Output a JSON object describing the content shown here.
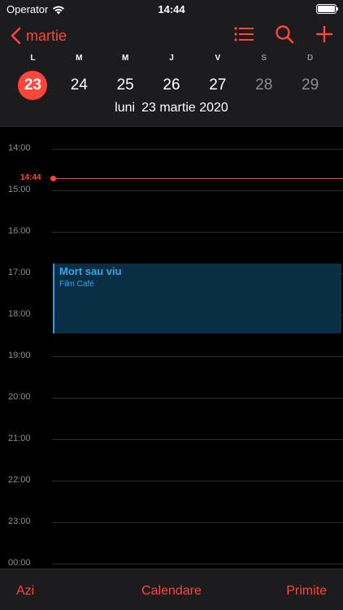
{
  "status_bar": {
    "carrier": "Operator",
    "time": "14:44"
  },
  "nav": {
    "back_label": "martie",
    "accent_color": "#ff453a",
    "icons": [
      "list-icon",
      "search-icon",
      "plus-icon"
    ]
  },
  "week": {
    "weekdays": [
      "L",
      "M",
      "M",
      "J",
      "V",
      "S",
      "D"
    ],
    "days": [
      "23",
      "24",
      "25",
      "26",
      "27",
      "28",
      "29"
    ],
    "selected_index": 0
  },
  "date_caption": {
    "weekday": "luni",
    "date": "23 martie 2020"
  },
  "timeline": {
    "hours": [
      "14:00",
      "15:00",
      "16:00",
      "17:00",
      "18:00",
      "19:00",
      "20:00",
      "21:00",
      "22:00",
      "23:00",
      "00:00"
    ],
    "now_label": "14:44"
  },
  "event": {
    "title": "Mort sau viu",
    "location": "Film Café",
    "color": "#33a6e8"
  },
  "toolbar": {
    "today": "Azi",
    "calendars": "Calendare",
    "inbox": "Primite"
  }
}
